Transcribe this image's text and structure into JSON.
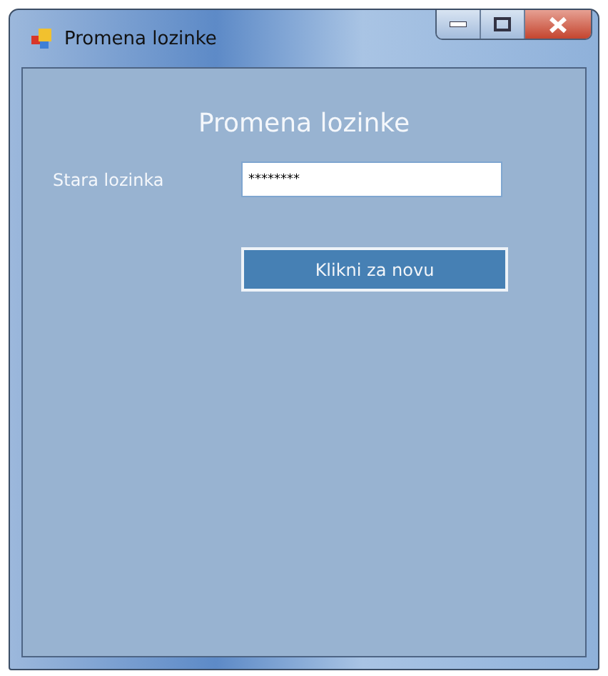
{
  "window": {
    "title": "Promena lozinke"
  },
  "form": {
    "heading": "Promena lozinke",
    "label": "Stara lozinka",
    "password": {
      "value": "********"
    },
    "button": "Klikni za novu"
  }
}
